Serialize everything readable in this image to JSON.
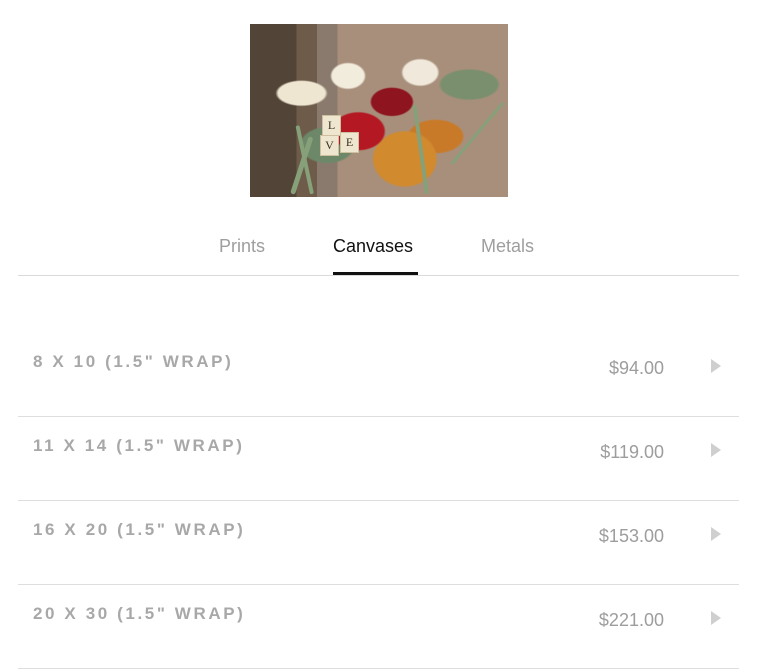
{
  "product_image": {
    "tiles": [
      "L",
      "V",
      "E"
    ]
  },
  "tabs": [
    {
      "label": "Prints"
    },
    {
      "label": "Canvases"
    },
    {
      "label": "Metals"
    }
  ],
  "active_tab": "Canvases",
  "options": [
    {
      "size": "8 X 10 (1.5\" WRAP)",
      "price": "$94.00"
    },
    {
      "size": "11 X 14 (1.5\" WRAP)",
      "price": "$119.00"
    },
    {
      "size": "16 X 20 (1.5\" WRAP)",
      "price": "$153.00"
    },
    {
      "size": "20 X 30 (1.5\" WRAP)",
      "price": "$221.00"
    }
  ],
  "icons": {
    "row_arrow": "chevron-right-icon"
  },
  "colors": {
    "text_active": "#111111",
    "text_muted": "#9e9e9e",
    "divider": "#dedede"
  }
}
